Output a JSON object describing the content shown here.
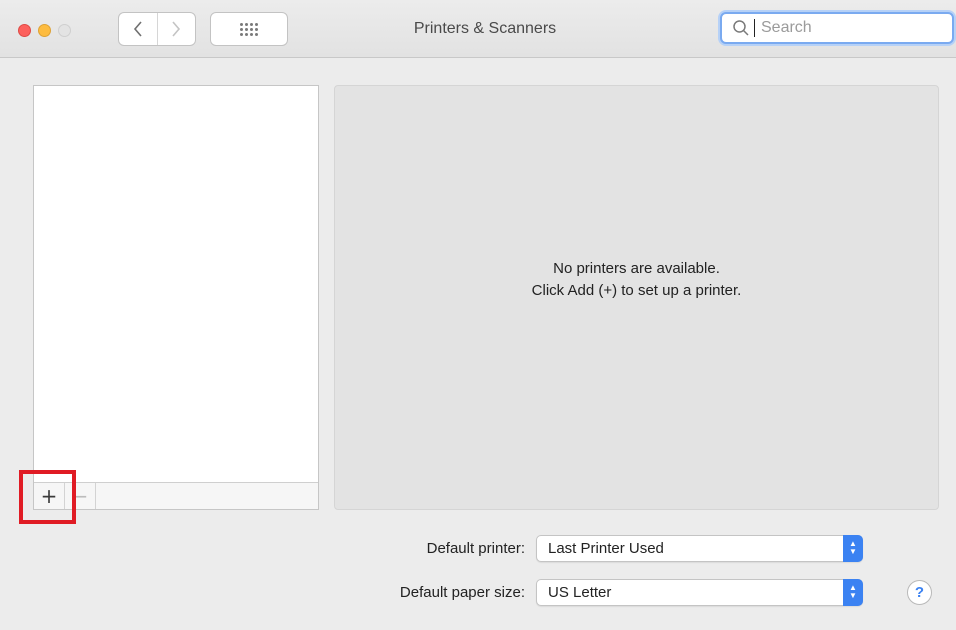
{
  "window": {
    "title": "Printers & Scanners"
  },
  "titlebar": {
    "back_icon": "chevron-left-icon",
    "forward_icon": "chevron-right-icon",
    "show_all_icon": "grid-icon"
  },
  "search": {
    "placeholder": "Search",
    "value": ""
  },
  "printer_list": {
    "items": [],
    "add_label": "+",
    "remove_label": "−"
  },
  "detail": {
    "line1": "No printers are available.",
    "line2": "Click Add (+) to set up a printer."
  },
  "defaults": {
    "printer_label": "Default printer:",
    "printer_value": "Last Printer Used",
    "paper_label": "Default paper size:",
    "paper_value": "US Letter"
  },
  "help": {
    "label": "?"
  },
  "colors": {
    "accent": "#3b82f2",
    "highlight_box": "#e01b24"
  }
}
